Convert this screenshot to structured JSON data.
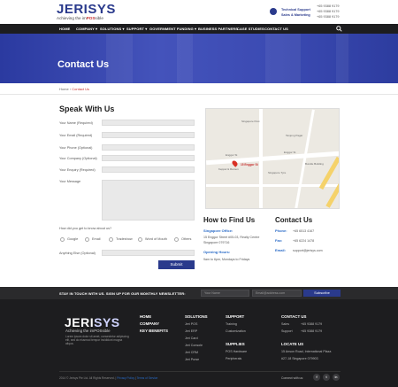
{
  "header": {
    "logo_text_a": "JERI",
    "logo_text_b": "SYS",
    "tagline_a": "Achieving the im",
    "tagline_b": "POS",
    "tagline_c": "sible",
    "support_label": "Technical Support",
    "sales_label": "Sales & Marketing",
    "support_phone": "+65 9388 9179",
    "sales_phone_1": "+65 9388 9179",
    "sales_phone_2": "+65 9388 9179"
  },
  "nav": {
    "items": [
      "HOME",
      "COMPANY ▾",
      "SOLUTIONS ▾",
      "SUPPORT ▾",
      "GOVERNMENT FUNDING ▾",
      "BUSINESS PARTNERS",
      "CASE STUDIES",
      "CONTACT US"
    ]
  },
  "hero": {
    "title": "Contact Us"
  },
  "breadcrumb": {
    "home": "Home",
    "sep": "›",
    "current": "Contact Us"
  },
  "form": {
    "title": "Speak With Us",
    "fields": [
      "Your Name (Required)",
      "Your Email (Required)",
      "Your Phone (Optional)",
      "Your Company (Optional)",
      "Your Enquiry (Required)",
      "Your Message"
    ],
    "question": "How did you get to know about us?",
    "options": [
      "Google",
      "Email",
      "Tradeshow",
      "Word of Mouth",
      "Others"
    ],
    "other_label": "Anything Else (Optional)",
    "submit": "Submit"
  },
  "map": {
    "street_1": "Enggor St",
    "street_2": "Enggor St",
    "pin_label": "15 Enggor St",
    "poi": [
      "Singapore Post",
      "Keppel & Ramen",
      "Tanjong Pagar",
      "Singapore Tyre",
      "Bundle Building"
    ]
  },
  "find": {
    "title": "How to Find Us",
    "office_label": "Singapore Office:",
    "address_1": "15 Enggor Street #05-03, Realty Centre",
    "address_2": "Singapore 079716",
    "hours_label": "Opening Hours:",
    "hours": "9am to 6pm, Mondays to Fridays"
  },
  "contact": {
    "title": "Contact Us",
    "phone_label": "Phone:",
    "phone": "+65 6513 4167",
    "fax_label": "Fax:",
    "fax": "+65 6224 1478",
    "email_label": "Email:",
    "email": "support@jerisys.com"
  },
  "newsletter": {
    "text": "STAY IN TOUCH WITH US. SIGN UP FOR OUR MONTHLY NEWSLETTER:",
    "name_placeholder": "Your Name",
    "email_placeholder": "Email@address.com",
    "button": "Subscribe"
  },
  "footer": {
    "logo_a": "JERI",
    "logo_b": "SYS",
    "tagline": "Achieving the imPOSsible",
    "desc": "Lorem ipsum dolor sit amet, consectetur adipiscing elit, sed do eiusmod tempor incididunt magna aliqua.",
    "links": [
      "HOME",
      "COMPANY",
      "KEY BENEFITS"
    ],
    "solutions_title": "SOLUTIONS",
    "solutions": [
      "Jeri POS",
      "Jeri ERP",
      "Jeri Card",
      "Jeri Console",
      "Jeri CRM",
      "Jeri Purse"
    ],
    "support_title": "SUPPORT",
    "support": [
      "Training",
      "Customization"
    ],
    "supplies_title": "SUPPLIES",
    "supplies": [
      "POS Hardware",
      "Peripherals"
    ],
    "contact_title": "CONTACT US",
    "contact_sales_label": "Sales",
    "contact_sales": "+65 9388 9179",
    "contact_support_label": "Support",
    "contact_support": "+65 9388 9179",
    "locate_title": "LOCATE US",
    "locate_1": "15 Anson Road, International Plaza",
    "locate_2": "#27-18 Singapore 079903",
    "copyright": "2014 © Jerisys Pte Ltd. All Rights Reserved. |",
    "privacy": "Privacy Policy",
    "sep": "|",
    "terms": "Terms of Service",
    "connect": "Connect with us:",
    "social": [
      "f",
      "t",
      "in"
    ]
  }
}
